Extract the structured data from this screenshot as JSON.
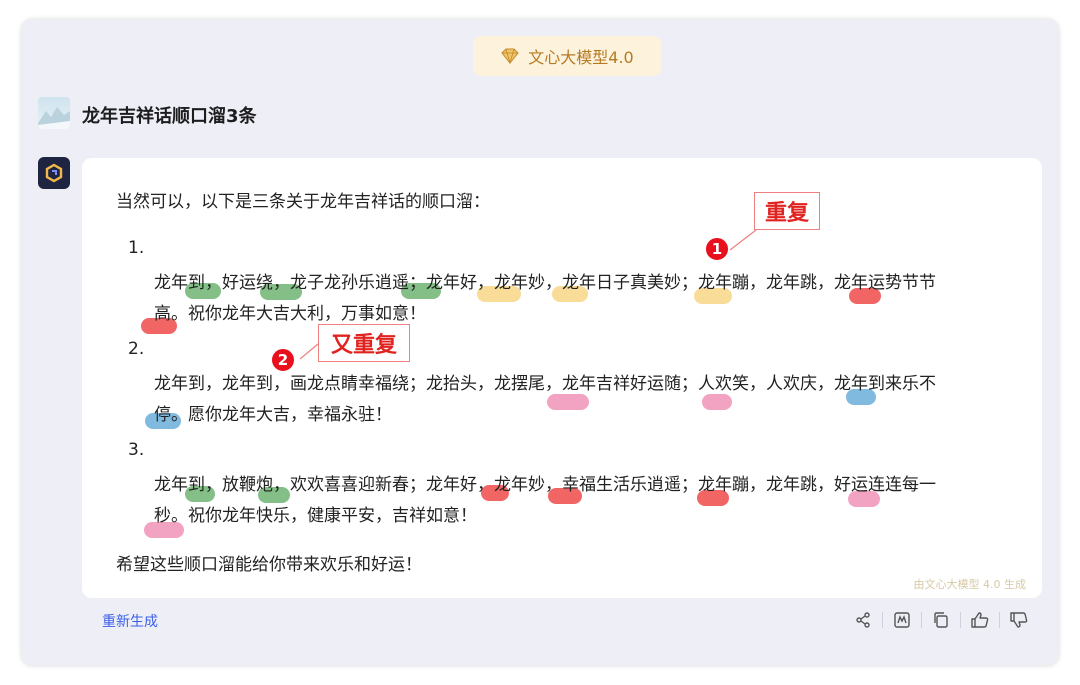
{
  "model_badge": {
    "label": "文心大模型4.0"
  },
  "user": {
    "question": "龙年吉祥话顺口溜3条"
  },
  "answer": {
    "intro": "当然可以，以下是三条关于龙年吉祥话的顺口溜：",
    "items": [
      {
        "num": "1.",
        "line1": "龙年到，好运绕，龙子龙孙乐逍遥；龙年好，龙年妙，龙年日子真美妙；龙年蹦，龙年跳，龙年运势节节",
        "line2": "高。祝你龙年大吉大利，万事如意！"
      },
      {
        "num": "2.",
        "line1": "龙年到，龙年到，画龙点睛幸福绕；龙抬头，龙摆尾，龙年吉祥好运随；人欢笑，人欢庆，龙年到来乐不",
        "line2": "停。愿你龙年大吉，幸福永驻！"
      },
      {
        "num": "3.",
        "line1": "龙年到，放鞭炮，欢欢喜喜迎新春；龙年好，龙年妙，幸福生活乐逍遥；龙年蹦，龙年跳，好运连连每一",
        "line2": "秒。祝你龙年快乐，健康平安，吉祥如意！"
      }
    ],
    "outro": "希望这些顺口溜能给你带来欢乐和好运！",
    "watermark": "由文心大模型 4.0 生成"
  },
  "annotations": {
    "marker1": "1",
    "tag1": "重复",
    "marker2": "2",
    "tag2": "又重复"
  },
  "footer": {
    "regenerate": "重新生成"
  },
  "icons": [
    "share-icon",
    "chart-icon",
    "copy-icon",
    "thumbs-up-icon",
    "thumbs-down-icon"
  ],
  "colors": {
    "accent": "#3a5fe8",
    "marker": "#e8101d",
    "badge_bg": "#fdf3dc"
  }
}
